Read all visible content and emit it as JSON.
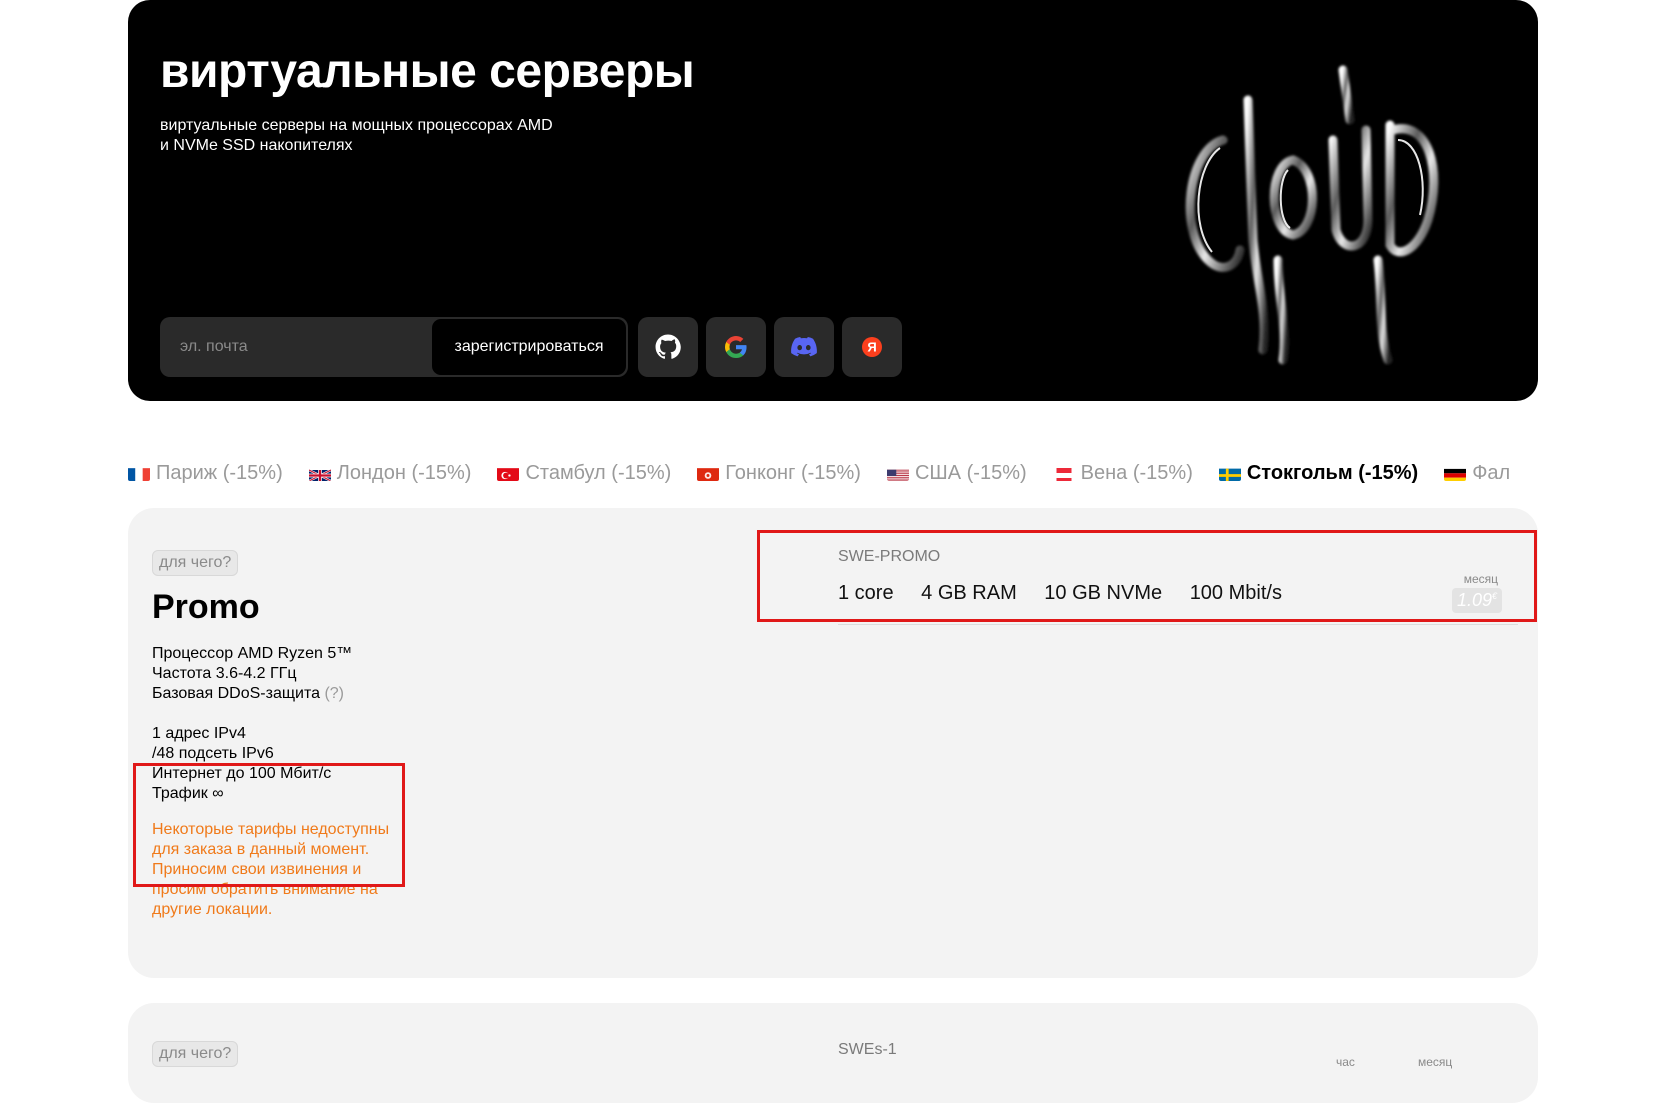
{
  "hero": {
    "title": "виртуальные серверы",
    "subtitle_line1": "виртуальные серверы на мощных процессорах AMD",
    "subtitle_line2": "и NVMe SSD накопителях",
    "email_placeholder": "эл. почта",
    "register_label": "зарегистрироваться",
    "social": [
      "github-icon",
      "google-icon",
      "discord-icon",
      "yandex-icon"
    ],
    "yandex_glyph": "Я",
    "art_text": "CLOUD"
  },
  "locations": [
    {
      "label": "Париж (-15%)",
      "flag": "fr",
      "active": false
    },
    {
      "label": "Лондон (-15%)",
      "flag": "gb",
      "active": false
    },
    {
      "label": "Стамбул (-15%)",
      "flag": "tr",
      "active": false
    },
    {
      "label": "Гонконг (-15%)",
      "flag": "hk",
      "active": false
    },
    {
      "label": "США (-15%)",
      "flag": "us",
      "active": false
    },
    {
      "label": "Вена (-15%)",
      "flag": "at",
      "active": false
    },
    {
      "label": "Стокгольм (-15%)",
      "flag": "se",
      "active": true
    },
    {
      "label": "Фал",
      "flag": "de",
      "active": false
    }
  ],
  "plan": {
    "why_label": "для чего?",
    "name": "Promo",
    "specs": [
      "Процессор AMD Ryzen 5™",
      "Частота 3.6-4.2 ГГц",
      "Базовая DDoS-защита",
      "",
      "1 адрес IPv4",
      "/48 подсеть IPv6",
      "Интернет до 100 Мбит/с",
      "Трафик ∞"
    ],
    "ddos_hint": "(?)",
    "notice": "Некоторые тарифы недоступны для заказа в данный момент. Приносим свои извинения и просим обратить внимание на другие локации.",
    "tariff": {
      "name": "SWE-PROMO",
      "cpu": "1 core",
      "ram": "4 GB RAM",
      "disk": "10 GB NVMe",
      "net": "100 Mbit/s",
      "period": "месяц",
      "price": "1.09",
      "currency": "€"
    }
  },
  "plan2": {
    "why_label": "для чего?",
    "tariff_name": "SWEs-1",
    "period_hour": "час",
    "period_month": "месяц"
  },
  "colors": {
    "notice": "#f07a1a",
    "highlight_box": "#e01818",
    "card_bg": "#f3f3f3",
    "hero_bg": "#000000"
  }
}
